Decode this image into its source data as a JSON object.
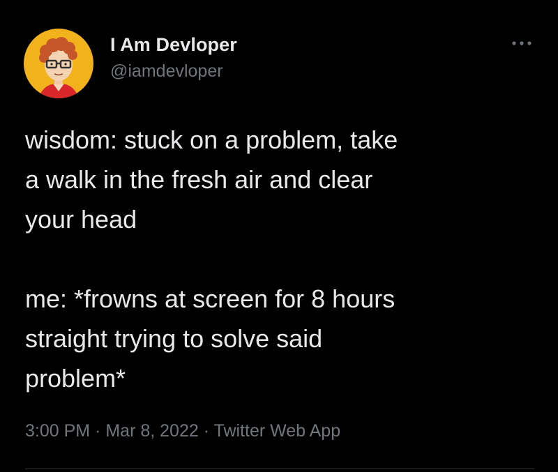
{
  "author": {
    "display_name": "I Am Devloper",
    "handle": "@iamdevloper",
    "avatar_icon": "cartoon-developer-avatar"
  },
  "more_icon": "ellipsis-icon",
  "tweet": {
    "text": "wisdom: stuck on a problem, take\na walk in the fresh air and clear\nyour head\n\nme: *frowns at screen for 8 hours\nstraight trying to solve said\nproblem*",
    "time": "3:00 PM",
    "separator": "·",
    "date": "Mar 8, 2022",
    "source": "Twitter Web App"
  },
  "colors": {
    "background": "#000000",
    "primary_text": "#e7e9ea",
    "secondary_text": "#71767b",
    "avatar_background": "#f2b21c"
  }
}
